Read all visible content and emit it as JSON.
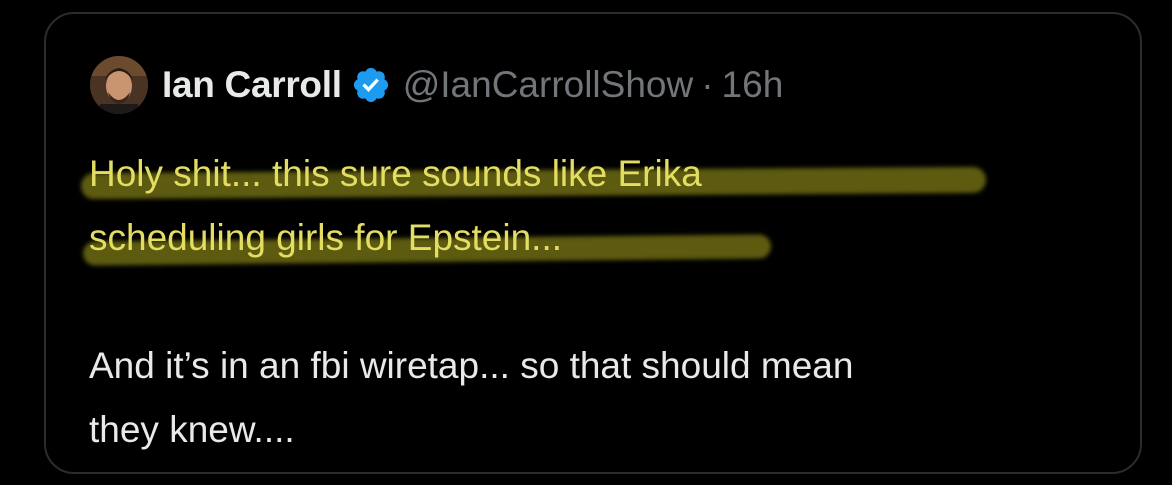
{
  "tweet": {
    "author": {
      "display_name": "Ian Carroll",
      "handle": "@IanCarrollShow",
      "separator": "·",
      "time": "16h",
      "verified_icon": "verified-badge-icon",
      "avatar_icon": "profile-photo"
    },
    "text": {
      "line1": "Holy shit... this sure sounds like Erika",
      "line2": "scheduling girls for Epstein...",
      "line3": "And it’s in an fbi wiretap... so that should mean",
      "line4": "they knew...."
    },
    "colors": {
      "background": "#000000",
      "card_border": "#2a2c30",
      "primary_text": "#e7e9ea",
      "secondary_text": "#71767b",
      "verified_blue": "#1d9bf0",
      "highlight_text": "#e3de63",
      "highlight_marker": "#aaa51e"
    }
  }
}
